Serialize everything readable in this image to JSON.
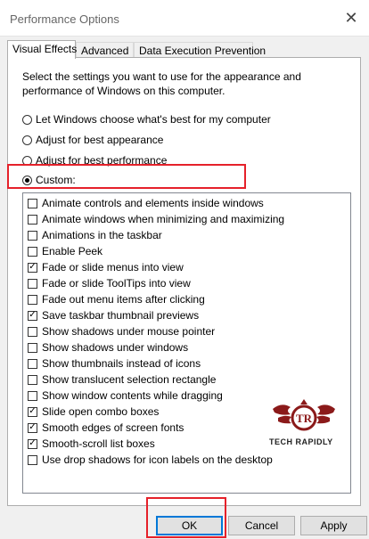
{
  "window": {
    "title": "Performance Options",
    "close_icon": "close-icon"
  },
  "tabs": [
    {
      "label": "Visual Effects",
      "active": true
    },
    {
      "label": "Advanced",
      "active": false
    },
    {
      "label": "Data Execution Prevention",
      "active": false
    }
  ],
  "description": "Select the settings you want to use for the appearance and performance of Windows on this computer.",
  "radios": [
    {
      "label": "Let Windows choose what's best for my computer",
      "selected": false
    },
    {
      "label": "Adjust for best appearance",
      "selected": false
    },
    {
      "label": "Adjust for best performance",
      "selected": false
    },
    {
      "label": "Custom:",
      "selected": true
    }
  ],
  "options": [
    {
      "label": "Animate controls and elements inside windows",
      "checked": false
    },
    {
      "label": "Animate windows when minimizing and maximizing",
      "checked": false
    },
    {
      "label": "Animations in the taskbar",
      "checked": false
    },
    {
      "label": "Enable Peek",
      "checked": false
    },
    {
      "label": "Fade or slide menus into view",
      "checked": true
    },
    {
      "label": "Fade or slide ToolTips into view",
      "checked": false
    },
    {
      "label": "Fade out menu items after clicking",
      "checked": false
    },
    {
      "label": "Save taskbar thumbnail previews",
      "checked": true
    },
    {
      "label": "Show shadows under mouse pointer",
      "checked": false
    },
    {
      "label": "Show shadows under windows",
      "checked": false
    },
    {
      "label": "Show thumbnails instead of icons",
      "checked": false
    },
    {
      "label": "Show translucent selection rectangle",
      "checked": false
    },
    {
      "label": "Show window contents while dragging",
      "checked": false
    },
    {
      "label": "Slide open combo boxes",
      "checked": true
    },
    {
      "label": "Smooth edges of screen fonts",
      "checked": true
    },
    {
      "label": "Smooth-scroll list boxes",
      "checked": true
    },
    {
      "label": "Use drop shadows for icon labels on the desktop",
      "checked": false
    }
  ],
  "watermark": {
    "monogram": "TR",
    "text": "TECH RAPIDLY"
  },
  "buttons": {
    "ok": "OK",
    "cancel": "Cancel",
    "apply": "Apply"
  },
  "colors": {
    "highlight_box": "#e5212a",
    "accent": "#0078d7",
    "logo_red": "#8b1a1a"
  }
}
